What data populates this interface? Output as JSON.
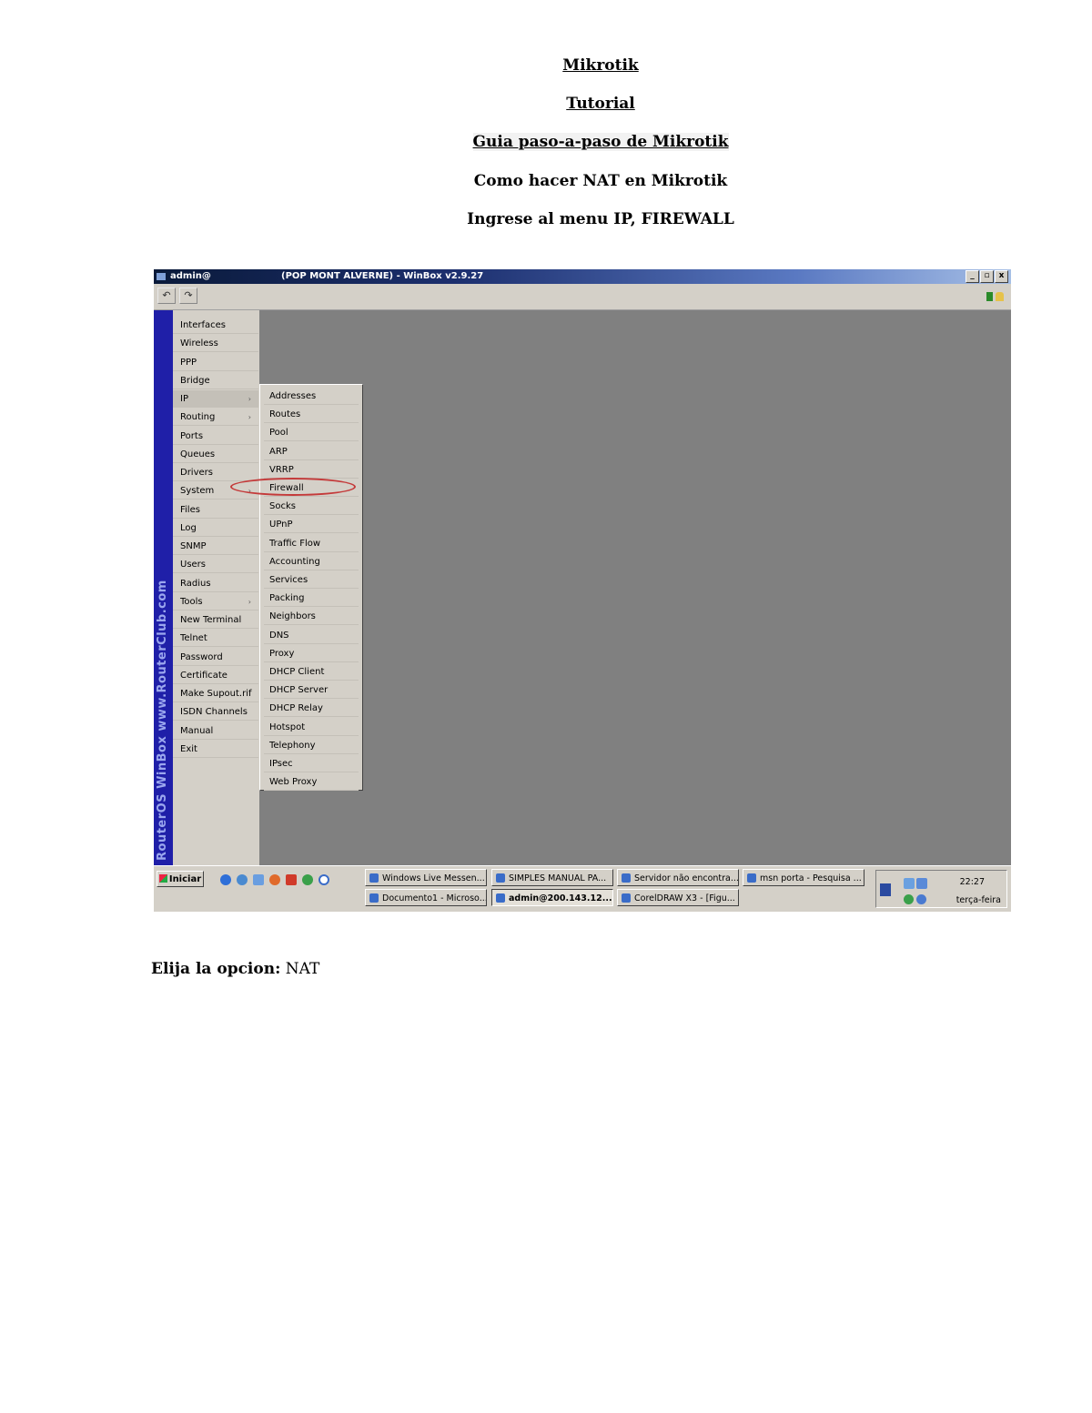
{
  "headings": {
    "h1": "Mikrotik",
    "h2": "Tutorial",
    "h3": "Guia paso-a-paso de Mikrotik",
    "h4": "Como hacer NAT en Mikrotik",
    "h5": "Ingrese al menu IP, FIREWALL"
  },
  "winbox": {
    "title_user": "admin@",
    "title": "(POP MONT ALVERNE) - WinBox v2.9.27",
    "win_buttons": [
      "_",
      "▫",
      "x"
    ],
    "toolbar": {
      "undo": "↶",
      "redo": "↷"
    },
    "sidebar_text": "RouterOS WinBox  www.RouterClub.com",
    "main_menu": [
      {
        "label": "Interfaces"
      },
      {
        "label": "Wireless"
      },
      {
        "label": "PPP"
      },
      {
        "label": "Bridge"
      },
      {
        "label": "IP",
        "arrow": "›"
      },
      {
        "label": "Routing",
        "arrow": "›"
      },
      {
        "label": "Ports"
      },
      {
        "label": "Queues"
      },
      {
        "label": "Drivers"
      },
      {
        "label": "System",
        "arrow": "›"
      },
      {
        "label": "Files"
      },
      {
        "label": "Log"
      },
      {
        "label": "SNMP"
      },
      {
        "label": "Users"
      },
      {
        "label": "Radius"
      },
      {
        "label": "Tools",
        "arrow": "›"
      },
      {
        "label": "New Terminal"
      },
      {
        "label": "Telnet"
      },
      {
        "label": "Password"
      },
      {
        "label": "Certificate"
      },
      {
        "label": "Make Supout.rif"
      },
      {
        "label": "ISDN Channels"
      },
      {
        "label": "Manual"
      },
      {
        "label": "Exit"
      }
    ],
    "ip_submenu": [
      "Addresses",
      "Routes",
      "Pool",
      "ARP",
      "VRRP",
      "Firewall",
      "Socks",
      "UPnP",
      "Traffic Flow",
      "Accounting",
      "Services",
      "Packing",
      "Neighbors",
      "DNS",
      "Proxy",
      "DHCP Client",
      "DHCP Server",
      "DHCP Relay",
      "Hotspot",
      "Telephony",
      "IPsec",
      "Web Proxy"
    ],
    "highlighted_item": "Firewall",
    "highlight_color": "#c43a3a"
  },
  "taskbar": {
    "start": "Iniciar",
    "tasks_row1": [
      "Windows Live Messen...",
      "SIMPLES MANUAL PA...",
      "Servidor não encontra...",
      "msn porta - Pesquisa ..."
    ],
    "tasks_row2": [
      "Documento1 - Microso...",
      "admin@200.143.12...",
      "CorelDRAW X3 - [Figu..."
    ],
    "active_task": "admin@200.143.12...",
    "clock_time": "22:27",
    "clock_day": "terça-feira"
  },
  "caption": {
    "label": "Elija la opcion:",
    "value": "NAT"
  }
}
